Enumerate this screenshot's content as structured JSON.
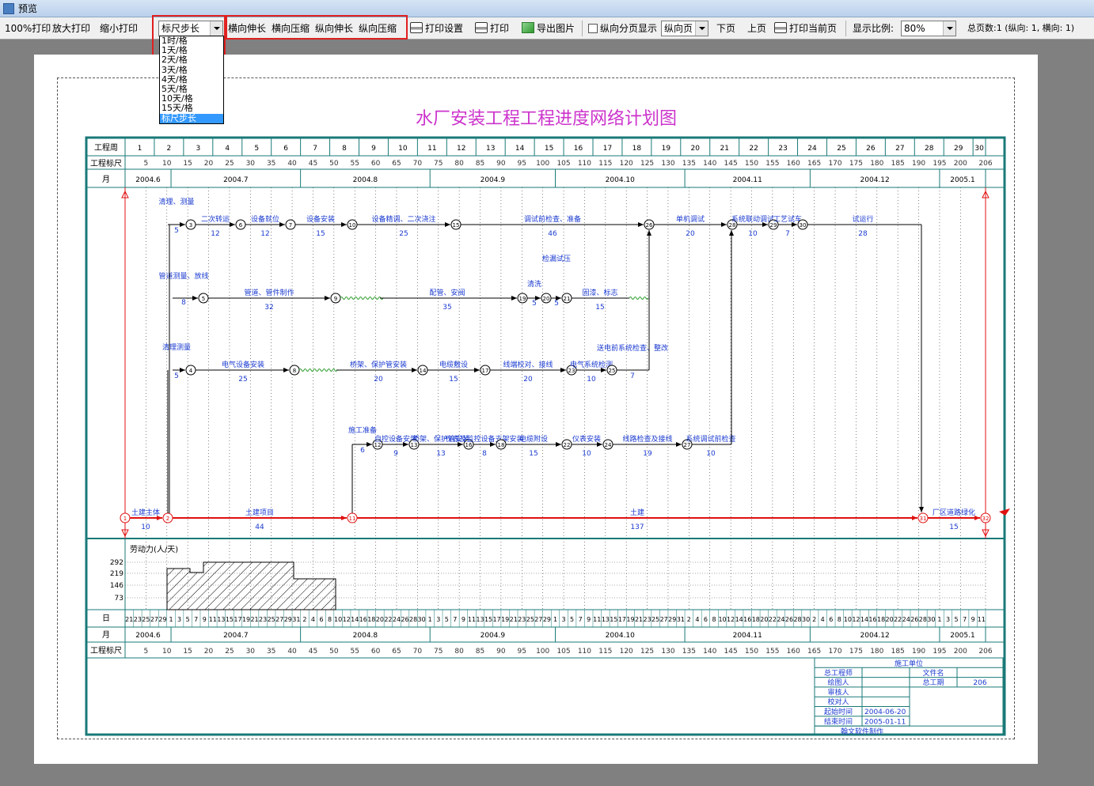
{
  "window": {
    "title": "预览"
  },
  "toolbar": {
    "print100": "100%打印",
    "zoom_in_print": "放大打印",
    "zoom_out_print": "缩小打印",
    "step_combo_value": "标尺步长",
    "h_stretch": "横向伸长",
    "h_compress": "横向压缩",
    "v_stretch": "纵向伸长",
    "v_compress": "纵向压缩",
    "print_setup": "打印设置",
    "print": "打印",
    "export_image": "导出图片",
    "vertical_paging": "纵向分页显示",
    "page_combo_value": "纵向页",
    "next_page": "下页",
    "prev_page": "上页",
    "print_current": "打印当前页",
    "scale_label": "显示比例:",
    "scale_value": "80%",
    "total_pages": "总页数:1 (纵向: 1, 横向: 1)"
  },
  "dropdown_options": [
    "1时/格",
    "1天/格",
    "2天/格",
    "3天/格",
    "4天/格",
    "5天/格",
    "10天/格",
    "15天/格",
    "标尺步长"
  ],
  "dropdown_selected": 8,
  "diagram": {
    "title": "水厂安装工程工程进度网络计划图",
    "row_labels": {
      "week": "工程周",
      "ruler": "工程标尺",
      "month": "月",
      "day": "日",
      "labor": "劳动力(人/天)"
    },
    "weeks": [
      "1",
      "2",
      "3",
      "4",
      "5",
      "6",
      "7",
      "8",
      "9",
      "10",
      "11",
      "12",
      "13",
      "14",
      "15",
      "16",
      "17",
      "18",
      "19",
      "20",
      "21",
      "22",
      "23",
      "24",
      "25",
      "26",
      "27",
      "28",
      "29",
      "30"
    ],
    "ruler": [
      "5",
      "10",
      "15",
      "20",
      "25",
      "30",
      "35",
      "40",
      "45",
      "50",
      "55",
      "60",
      "65",
      "70",
      "75",
      "80",
      "85",
      "90",
      "95",
      "100",
      "105",
      "110",
      "115",
      "120",
      "125",
      "130",
      "135",
      "140",
      "145",
      "150",
      "155",
      "160",
      "165",
      "170",
      "175",
      "180",
      "185",
      "190",
      "195",
      "200",
      "206"
    ],
    "months": [
      "2004.6",
      "2004.7",
      "2004.8",
      "2004.9",
      "2004.10",
      "2004.11",
      "2004.12",
      "2005.1"
    ],
    "labor_ticks": [
      "292",
      "219",
      "146",
      "73"
    ],
    "days": [
      "21",
      "23",
      "25",
      "27",
      "29",
      "1",
      "3",
      "5",
      "7",
      "9",
      "11",
      "13",
      "15",
      "17",
      "19",
      "21",
      "23",
      "25",
      "27",
      "29",
      "31",
      "2",
      "4",
      "6",
      "8",
      "10",
      "12",
      "14",
      "16",
      "18",
      "20",
      "22",
      "24",
      "26",
      "28",
      "30",
      "1",
      "3",
      "5",
      "7",
      "9",
      "11",
      "13",
      "15",
      "17",
      "19",
      "21",
      "23",
      "25",
      "27",
      "29",
      "1",
      "3",
      "5",
      "7",
      "9",
      "11",
      "13",
      "15",
      "17",
      "19",
      "21",
      "23",
      "25",
      "27",
      "29",
      "31",
      "2",
      "4",
      "6",
      "8",
      "10",
      "12",
      "14",
      "16",
      "18",
      "20",
      "22",
      "24",
      "26",
      "28",
      "30",
      "2",
      "4",
      "6",
      "8",
      "10",
      "12",
      "14",
      "16",
      "18",
      "20",
      "22",
      "24",
      "26",
      "28",
      "30",
      "1",
      "3",
      "5",
      "7",
      "9",
      "11"
    ],
    "tasks": [
      {
        "label": "清理、测量",
        "dur": "5"
      },
      {
        "label": "二次转运",
        "dur": "12"
      },
      {
        "label": "设备就位",
        "dur": "12"
      },
      {
        "label": "设备安装",
        "dur": "15"
      },
      {
        "label": "设备精调、二次浇注",
        "dur": "25"
      },
      {
        "label": "调试前检查、准备",
        "dur": "46"
      },
      {
        "label": "单机调试",
        "dur": "20"
      },
      {
        "label": "系统联动调试",
        "dur": "10"
      },
      {
        "label": "工艺试车",
        "dur": "7"
      },
      {
        "label": "试运行",
        "dur": "28"
      },
      {
        "label": "管道测量、放线",
        "dur": "8"
      },
      {
        "label": "管道、管件制作",
        "dur": "32"
      },
      {
        "label": "配管、安阀",
        "dur": "35"
      },
      {
        "label": "清洗",
        "dur": "5"
      },
      {
        "label": "检漏试压",
        "dur": "5"
      },
      {
        "label": "固漆、标志",
        "dur": "15"
      },
      {
        "label": "清理测量",
        "dur": "5"
      },
      {
        "label": "电气设备安装",
        "dur": "25"
      },
      {
        "label": "桥架、保护管安装",
        "dur": "20"
      },
      {
        "label": "电缆敷设",
        "dur": "15"
      },
      {
        "label": "线端校对、接线",
        "dur": "20"
      },
      {
        "label": "电气系统检测",
        "dur": "10"
      },
      {
        "label": "送电前系统检查、整改",
        "dur": "7"
      },
      {
        "label": "施工准备",
        "dur": "6"
      },
      {
        "label": "自控设备安装",
        "dur": "9"
      },
      {
        "label": "桥架、保护管安装",
        "dur": "13"
      },
      {
        "label": "仪表及监控设备支架安装",
        "dur": "8"
      },
      {
        "label": "电缆附设",
        "dur": "15"
      },
      {
        "label": "仪表安装",
        "dur": "10"
      },
      {
        "label": "线路检查及接线",
        "dur": "19"
      },
      {
        "label": "系统调试前检查",
        "dur": "10"
      },
      {
        "label": "土建主体",
        "dur": "10"
      },
      {
        "label": "土建项目",
        "dur": "44"
      },
      {
        "label": "土建",
        "dur": "137"
      },
      {
        "label": "厂区道路绿化",
        "dur": "15"
      }
    ],
    "nodes": [
      "1",
      "2",
      "3",
      "4",
      "5",
      "6",
      "7",
      "8",
      "9",
      "10",
      "11",
      "12",
      "13",
      "14",
      "15",
      "16",
      "17",
      "18",
      "19",
      "20",
      "21",
      "22",
      "23",
      "24",
      "25",
      "26",
      "27",
      "28",
      "29",
      "30",
      "31",
      "32"
    ],
    "info_table": {
      "header": "施工单位",
      "chief_engineer": "总工程师",
      "drawer": "绘图人",
      "reviewer": "审核人",
      "checker": "校对人",
      "start_label": "起始时间",
      "start_value": "2004-06-20",
      "end_label": "结束时间",
      "end_value": "2005-01-11",
      "file_label": "文件名",
      "period_label": "总工期",
      "period_value": "206",
      "software": "翰文软件制作"
    }
  }
}
